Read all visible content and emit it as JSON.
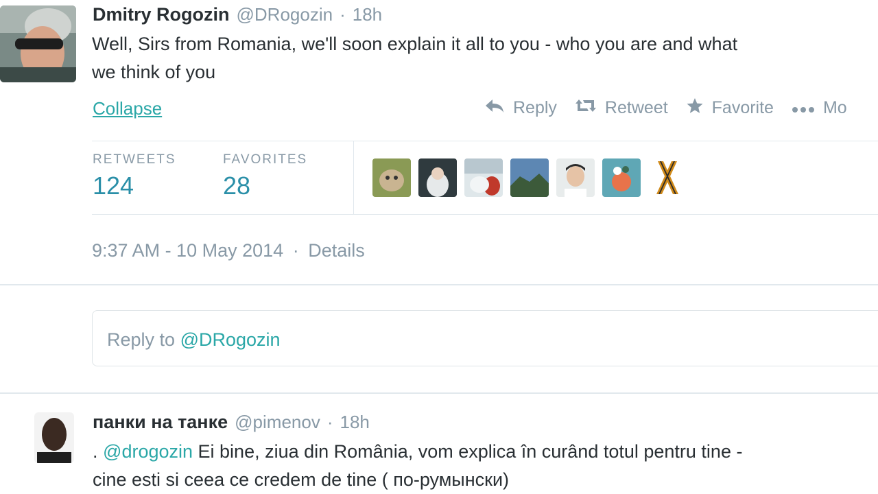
{
  "main_tweet": {
    "name": "Dmitry Rogozin",
    "handle": "@DRogozin",
    "separator": "·",
    "time": "18h",
    "text_line1": "Well, Sirs from Romania, we'll soon explain it all to you - who you are and what",
    "text_line2": "we think of you",
    "collapse": "Collapse",
    "actions": {
      "reply": "Reply",
      "retweet": "Retweet",
      "favorite": "Favorite",
      "more": "Mo"
    },
    "stats": {
      "retweets_label": "RETWEETS",
      "retweets_value": "124",
      "favorites_label": "FAVORITES",
      "favorites_value": "28"
    },
    "timestamp": "9:37 AM - 10 May 2014",
    "details": "Details"
  },
  "reply_box": {
    "prefix": "Reply to ",
    "mention": "@DRogozin"
  },
  "reply_tweet": {
    "name": "панки на танке",
    "handle": "@pimenov",
    "separator": "·",
    "time": "18h",
    "lead": ".",
    "mention": "@drogozin",
    "text_line1": "Ei bine, ziua din România, vom explica în curând totul pentru tine -",
    "text_line2": "cine esti si ceea ce credem de tine ( по-румынски)"
  },
  "colors": {
    "accent": "#2aa7a7",
    "muted": "#8899a6",
    "text": "#292f33",
    "stat_value": "#2a8fa8"
  }
}
